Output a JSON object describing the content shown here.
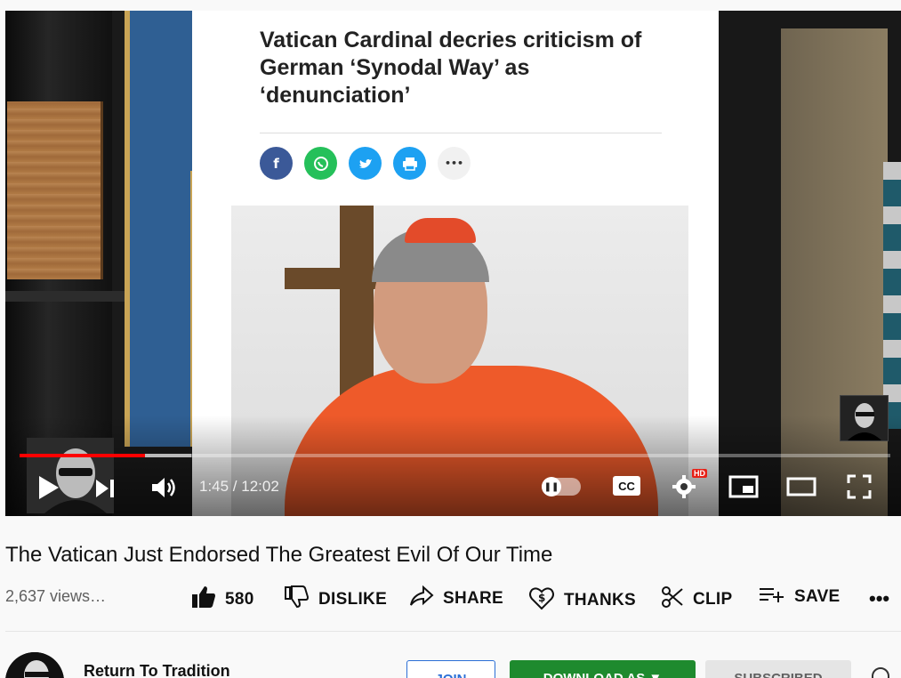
{
  "player": {
    "article": {
      "headline": "Vatican Cardinal decries criticism of German ‘Synodal Way’ as ‘denunciation’",
      "share_buttons": [
        {
          "icon": "facebook-icon",
          "color": "#3b5998"
        },
        {
          "icon": "whatsapp-icon",
          "color": "#25c05a"
        },
        {
          "icon": "twitter-icon",
          "color": "#1da1f2"
        },
        {
          "icon": "print-icon",
          "color": "#1da1f2"
        },
        {
          "icon": "more-icon",
          "color": "#f1f1f1"
        }
      ],
      "more_glyph": "•••"
    },
    "progress": {
      "played_fraction": 0.144,
      "buffered_fraction": 0.197,
      "color": "#ff0000"
    },
    "time": "1:45 / 12:02",
    "cc_label": "CC",
    "hd_label": "HD"
  },
  "video": {
    "title": "The Vatican Just Endorsed The Greatest Evil Of Our Time",
    "views": "2,637 views…"
  },
  "actions": {
    "like_count": "580",
    "dislike_label": "DISLIKE",
    "share_label": "SHARE",
    "thanks_label": "THANKS",
    "clip_label": "CLIP",
    "save_label": "SAVE",
    "more_glyph": "•••"
  },
  "channel": {
    "name": "Return To Tradition",
    "join_label": "JOIN",
    "download_label": "DOWNLOAD AS ▼",
    "subscribed_label": "SUBSCRIBED"
  }
}
